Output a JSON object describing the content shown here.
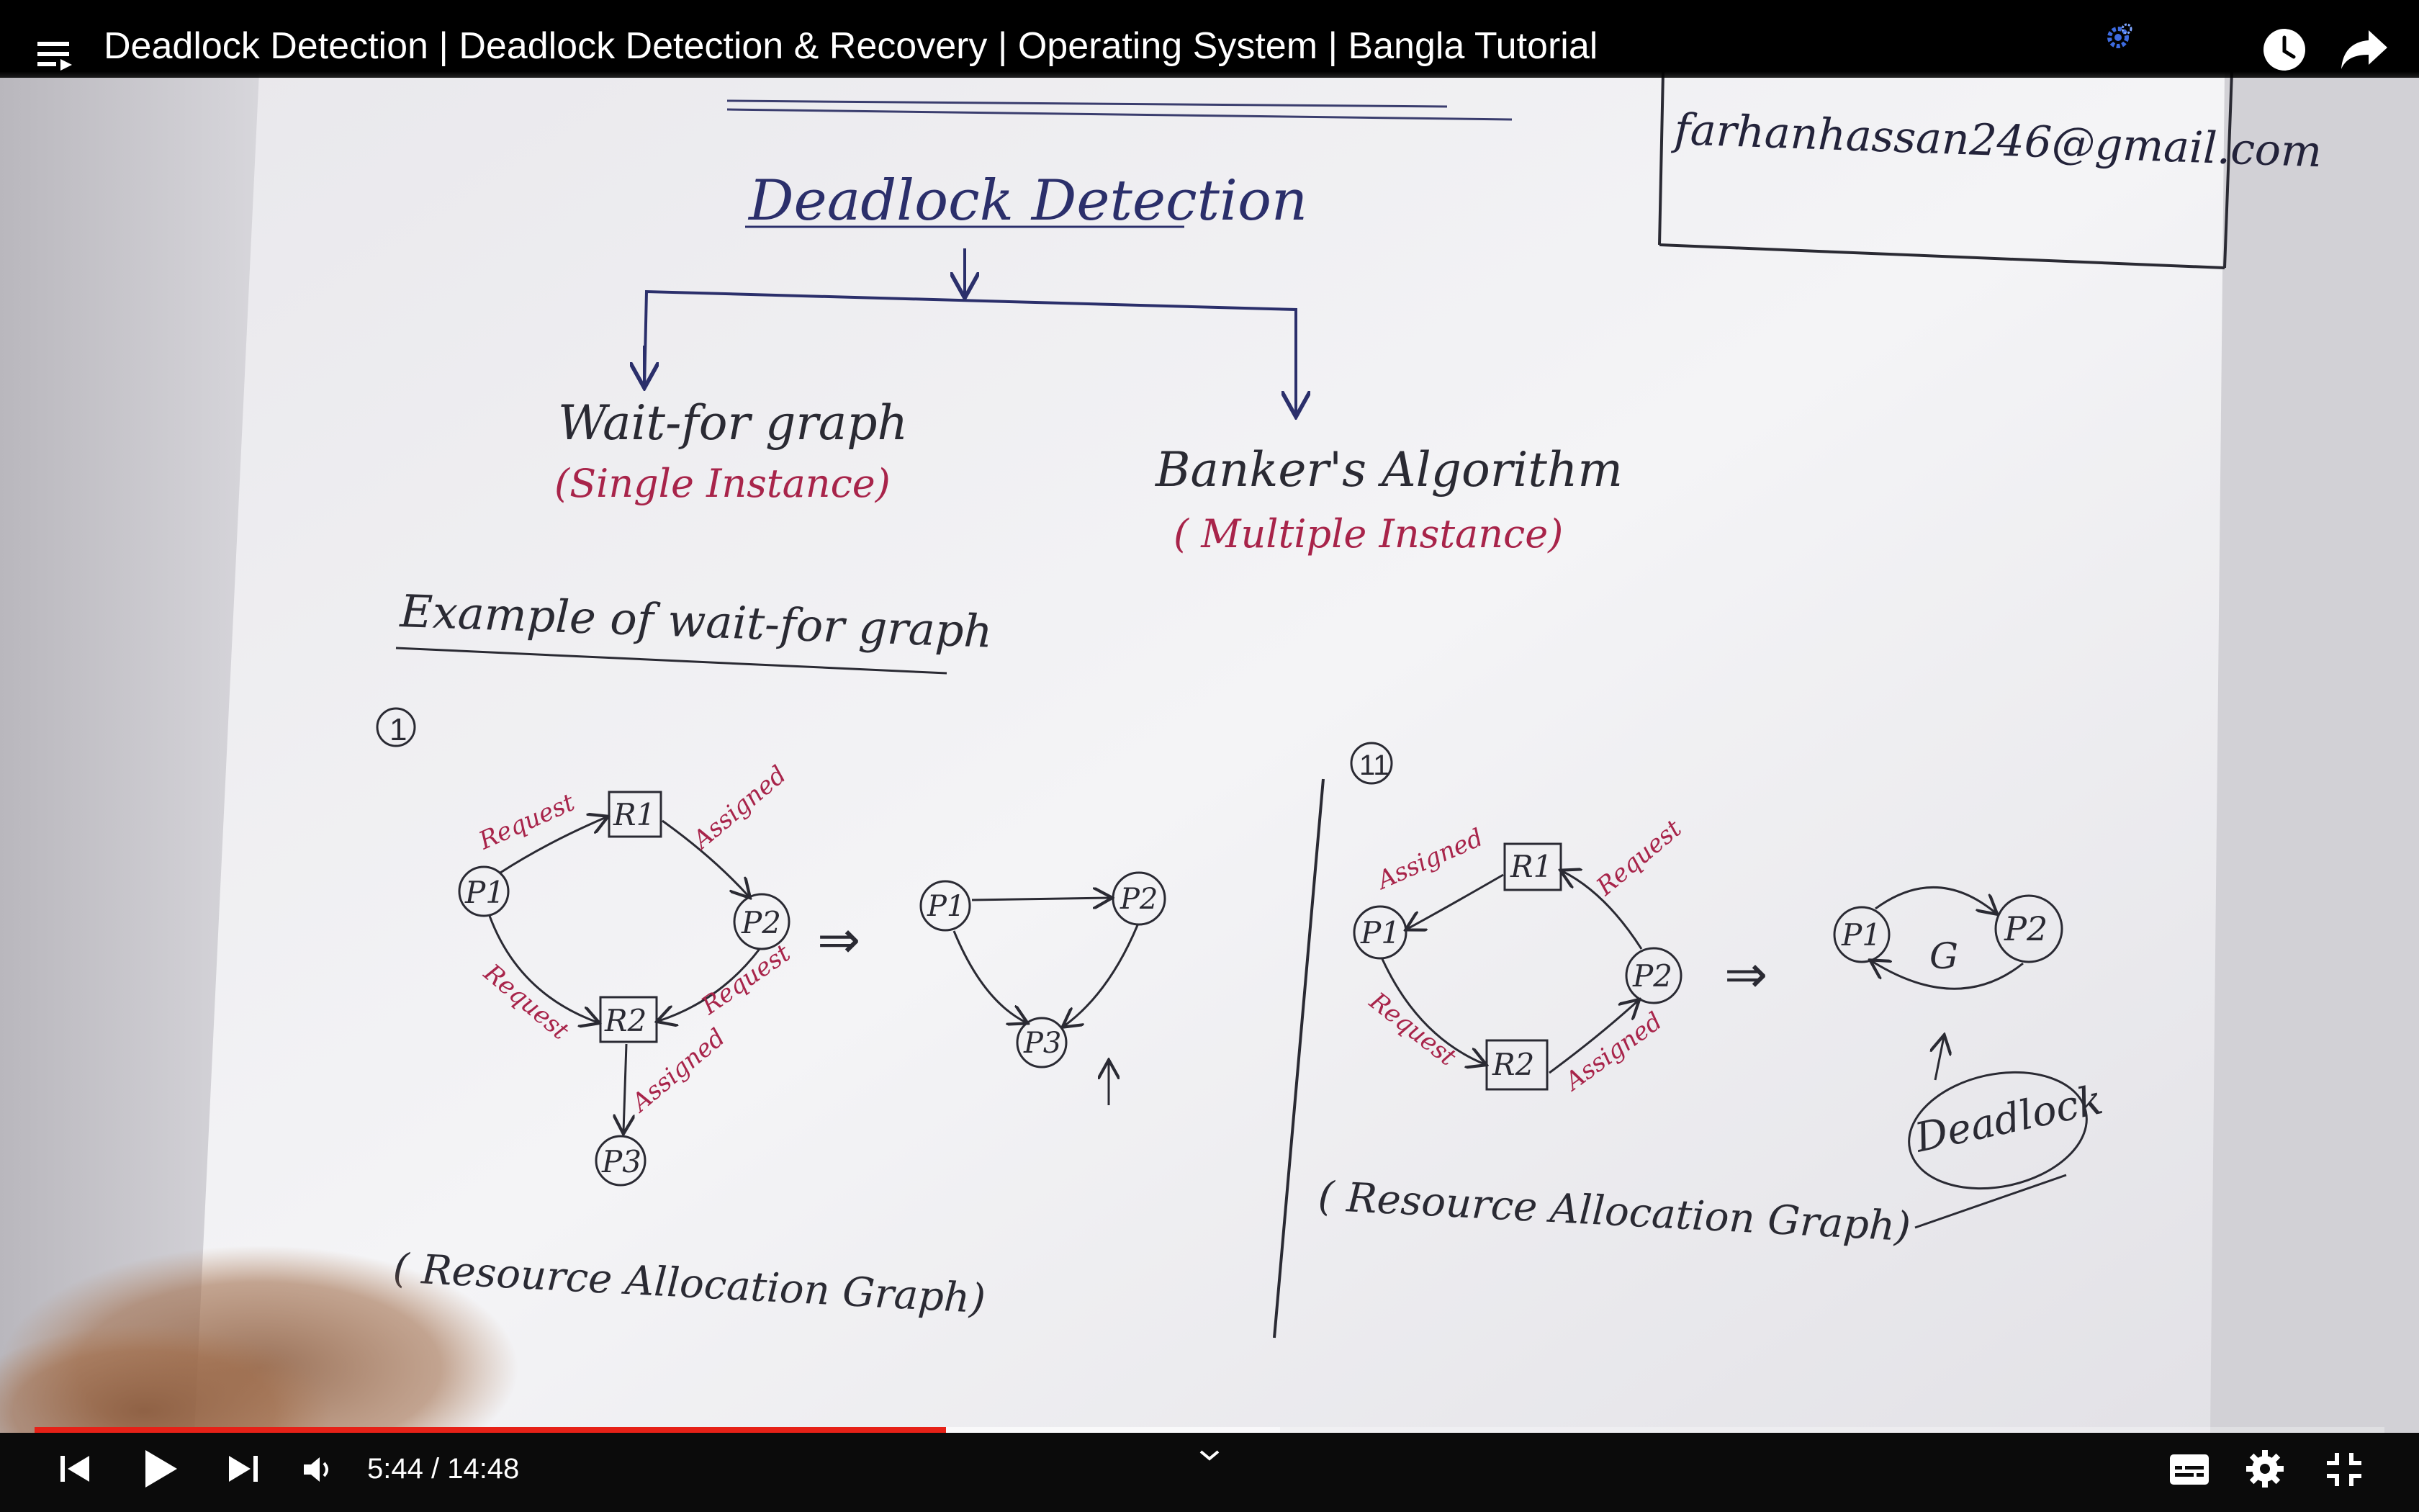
{
  "video": {
    "title": "Deadlock Detection | Deadlock Detection & Recovery | Operating System | Bangla Tutorial"
  },
  "board": {
    "email": "farhanhassan246@gmail.com",
    "heading": "Deadlock Detection",
    "left_branch": "Wait-for graph",
    "left_branch_note": "(Single Instance)",
    "right_branch": "Banker's Algorithm",
    "right_branch_note": "( Multiple Instance)",
    "example_heading": "Example of wait-for graph",
    "example1_marker": "1",
    "example2_marker": "11",
    "rag_caption": "( Resource Allocation Graph)",
    "deadlock_label": "Deadlock",
    "g_label": "G",
    "implies": "⇒",
    "nodes": {
      "p1": "P1",
      "p2": "P2",
      "p3": "P3",
      "r1": "R1",
      "r2": "R2"
    },
    "edge_labels": {
      "request": "Request",
      "assigned": "Assigned"
    }
  },
  "controls": {
    "time_current": "5:44",
    "time_total": "14:48",
    "time_separator": " / ",
    "progress_played": 0.388,
    "progress_buffered": 0.53
  },
  "colors": {
    "progress": "#e62117",
    "pen_blue": "#2b2f6b",
    "pen_red": "#a8244a"
  }
}
